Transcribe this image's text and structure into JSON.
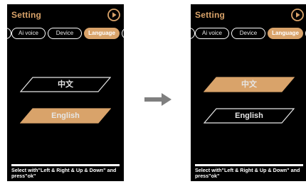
{
  "colors": {
    "accent": "#d9a36a",
    "screen_bg": "#000000",
    "text": "#e6e6e6",
    "arrow": "#7f7f7f"
  },
  "screens": [
    {
      "title": "Setting",
      "play_icon": "play-icon",
      "tabs": [
        {
          "label": ""
        },
        {
          "label": "Ai voice"
        },
        {
          "label": "Device"
        },
        {
          "label": "Language"
        },
        {
          "label": ""
        }
      ],
      "selected_tab": "Language",
      "options": [
        {
          "label": "中文",
          "selected": false
        },
        {
          "label": "English",
          "selected": true
        }
      ],
      "hint": "Select with\"Left & Right & Up & Down\" and press\"ok\""
    },
    {
      "title": "Setting",
      "play_icon": "play-icon",
      "tabs": [
        {
          "label": ""
        },
        {
          "label": "Ai voice"
        },
        {
          "label": "Device"
        },
        {
          "label": "Language"
        },
        {
          "label": ""
        }
      ],
      "selected_tab": "Language",
      "options": [
        {
          "label": "中文",
          "selected": true
        },
        {
          "label": "English",
          "selected": false
        }
      ],
      "hint": "Select with\"Left & Right & Up & Down\" and press\"ok\""
    }
  ],
  "transition_icon": "arrow-right-icon"
}
